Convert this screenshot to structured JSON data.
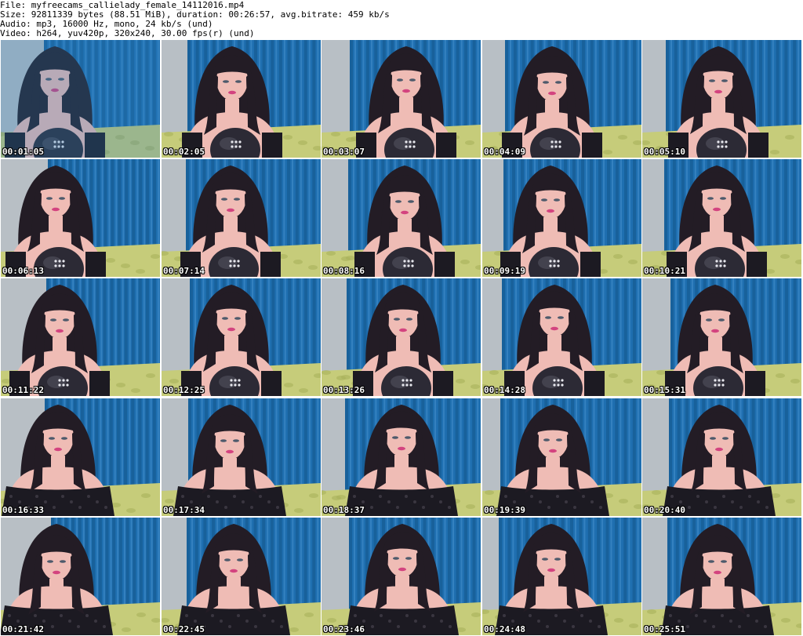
{
  "header": {
    "file_line": "File: myfreecams_callielady_female_14112016.mp4",
    "size_line": "Size: 92811339 bytes (88.51 MiB), duration: 00:26:57, avg.bitrate: 459 kb/s",
    "audio_line": "Audio: mp3, 16000 Hz, mono, 24 kb/s (und)",
    "video_line": "Video: h264, yuv420p, 320x240, 30.00 fps(r) (und)"
  },
  "thumbnails": [
    {
      "time": "00:01:05"
    },
    {
      "time": "00:02:05"
    },
    {
      "time": "00:03:07"
    },
    {
      "time": "00:04:09"
    },
    {
      "time": "00:05:10"
    },
    {
      "time": "00:06:13"
    },
    {
      "time": "00:07:14"
    },
    {
      "time": "00:08:16"
    },
    {
      "time": "00:09:19"
    },
    {
      "time": "00:10:21"
    },
    {
      "time": "00:11:22"
    },
    {
      "time": "00:12:25"
    },
    {
      "time": "00:13:26"
    },
    {
      "time": "00:14:28"
    },
    {
      "time": "00:15:31"
    },
    {
      "time": "00:16:33"
    },
    {
      "time": "00:17:34"
    },
    {
      "time": "00:18:37"
    },
    {
      "time": "00:19:39"
    },
    {
      "time": "00:20:40"
    },
    {
      "time": "00:21:42"
    },
    {
      "time": "00:22:45"
    },
    {
      "time": "00:23:46"
    },
    {
      "time": "00:24:48"
    },
    {
      "time": "00:25:51"
    }
  ],
  "colors": {
    "wall": "#c9ced2",
    "curtain": "#1f6fb0",
    "curtain_dark": "#155b93",
    "bedspread": "#c6cc7a",
    "hair": "#231c25",
    "skin": "#efbcb5",
    "clothing": "#1c1a22",
    "lips": "#d3437f"
  }
}
